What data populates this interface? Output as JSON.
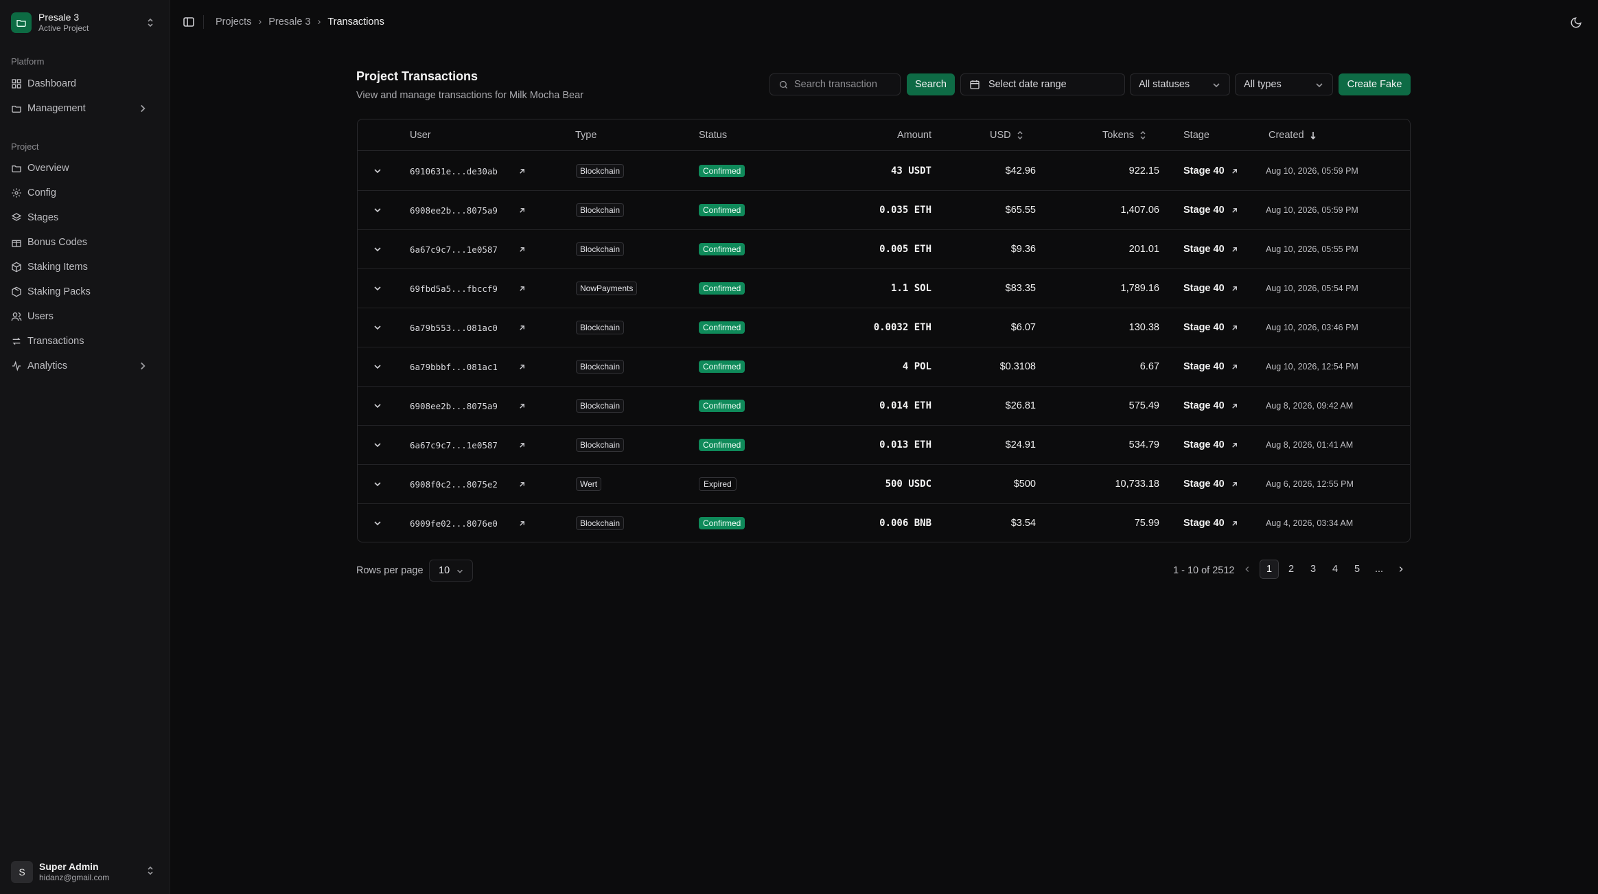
{
  "sidebar": {
    "project": {
      "name": "Presale 3",
      "subtitle": "Active Project"
    },
    "sections": [
      {
        "label": "Platform"
      },
      {
        "label": "Project"
      }
    ],
    "platform_items": [
      {
        "label": "Dashboard",
        "icon": "dashboard-icon"
      },
      {
        "label": "Management",
        "icon": "folder-icon"
      }
    ],
    "project_items": [
      {
        "label": "Overview",
        "icon": "folder-icon"
      },
      {
        "label": "Config",
        "icon": "gear-icon"
      },
      {
        "label": "Stages",
        "icon": "layers-icon"
      },
      {
        "label": "Bonus Codes",
        "icon": "gift-icon"
      },
      {
        "label": "Staking Items",
        "icon": "cube-icon"
      },
      {
        "label": "Staking Packs",
        "icon": "package-icon"
      },
      {
        "label": "Users",
        "icon": "users-icon"
      },
      {
        "label": "Transactions",
        "icon": "transfer-icon"
      },
      {
        "label": "Analytics",
        "icon": "activity-icon"
      }
    ],
    "user": {
      "initial": "S",
      "name": "Super Admin",
      "email": "hidanz@gmail.com"
    }
  },
  "breadcrumb": [
    "Projects",
    "Presale 3",
    "Transactions"
  ],
  "header": {
    "title": "Project Transactions",
    "description": "View and manage transactions for Milk Mocha Bear"
  },
  "toolbar": {
    "search_placeholder": "Search transaction",
    "search_label": "Search",
    "date_label": "Select date range",
    "status_select": "All statuses",
    "type_select": "All types",
    "create_label": "Create Fake"
  },
  "table": {
    "columns": {
      "user": "User",
      "type": "Type",
      "status": "Status",
      "amount": "Amount",
      "usd": "USD",
      "tokens": "Tokens",
      "stage": "Stage",
      "created": "Created"
    },
    "rows": [
      {
        "user": "6910631e...de30ab",
        "type": "Blockchain",
        "status": "Confirmed",
        "amount": "43 USDT",
        "usd": "$42.96",
        "tokens": "922.15",
        "stage": "Stage 40",
        "created": "Aug 10, 2026, 05:59 PM"
      },
      {
        "user": "6908ee2b...8075a9",
        "type": "Blockchain",
        "status": "Confirmed",
        "amount": "0.035 ETH",
        "usd": "$65.55",
        "tokens": "1,407.06",
        "stage": "Stage 40",
        "created": "Aug 10, 2026, 05:59 PM"
      },
      {
        "user": "6a67c9c7...1e0587",
        "type": "Blockchain",
        "status": "Confirmed",
        "amount": "0.005 ETH",
        "usd": "$9.36",
        "tokens": "201.01",
        "stage": "Stage 40",
        "created": "Aug 10, 2026, 05:55 PM"
      },
      {
        "user": "69fbd5a5...fbccf9",
        "type": "NowPayments",
        "status": "Confirmed",
        "amount": "1.1 SOL",
        "usd": "$83.35",
        "tokens": "1,789.16",
        "stage": "Stage 40",
        "created": "Aug 10, 2026, 05:54 PM"
      },
      {
        "user": "6a79b553...081ac0",
        "type": "Blockchain",
        "status": "Confirmed",
        "amount": "0.0032 ETH",
        "usd": "$6.07",
        "tokens": "130.38",
        "stage": "Stage 40",
        "created": "Aug 10, 2026, 03:46 PM"
      },
      {
        "user": "6a79bbbf...081ac1",
        "type": "Blockchain",
        "status": "Confirmed",
        "amount": "4 POL",
        "usd": "$0.3108",
        "tokens": "6.67",
        "stage": "Stage 40",
        "created": "Aug 10, 2026, 12:54 PM"
      },
      {
        "user": "6908ee2b...8075a9",
        "type": "Blockchain",
        "status": "Confirmed",
        "amount": "0.014 ETH",
        "usd": "$26.81",
        "tokens": "575.49",
        "stage": "Stage 40",
        "created": "Aug 8, 2026, 09:42 AM"
      },
      {
        "user": "6a67c9c7...1e0587",
        "type": "Blockchain",
        "status": "Confirmed",
        "amount": "0.013 ETH",
        "usd": "$24.91",
        "tokens": "534.79",
        "stage": "Stage 40",
        "created": "Aug 8, 2026, 01:41 AM"
      },
      {
        "user": "6908f0c2...8075e2",
        "type": "Wert",
        "status": "Expired",
        "amount": "500 USDC",
        "usd": "$500",
        "tokens": "10,733.18",
        "stage": "Stage 40",
        "created": "Aug 6, 2026, 12:55 PM"
      },
      {
        "user": "6909fe02...8076e0",
        "type": "Blockchain",
        "status": "Confirmed",
        "amount": "0.006 BNB",
        "usd": "$3.54",
        "tokens": "75.99",
        "stage": "Stage 40",
        "created": "Aug 4, 2026, 03:34 AM"
      }
    ]
  },
  "pagination": {
    "rows_label": "Rows per page",
    "rows_value": "10",
    "range_text": "1 - 10 of 2512",
    "pages": [
      "1",
      "2",
      "3",
      "4",
      "5",
      "..."
    ]
  },
  "colors": {
    "accent": "#0e6b45",
    "confirmed": "#0f8a5a",
    "background": "#0c0c0d",
    "sidebar": "#141416"
  }
}
